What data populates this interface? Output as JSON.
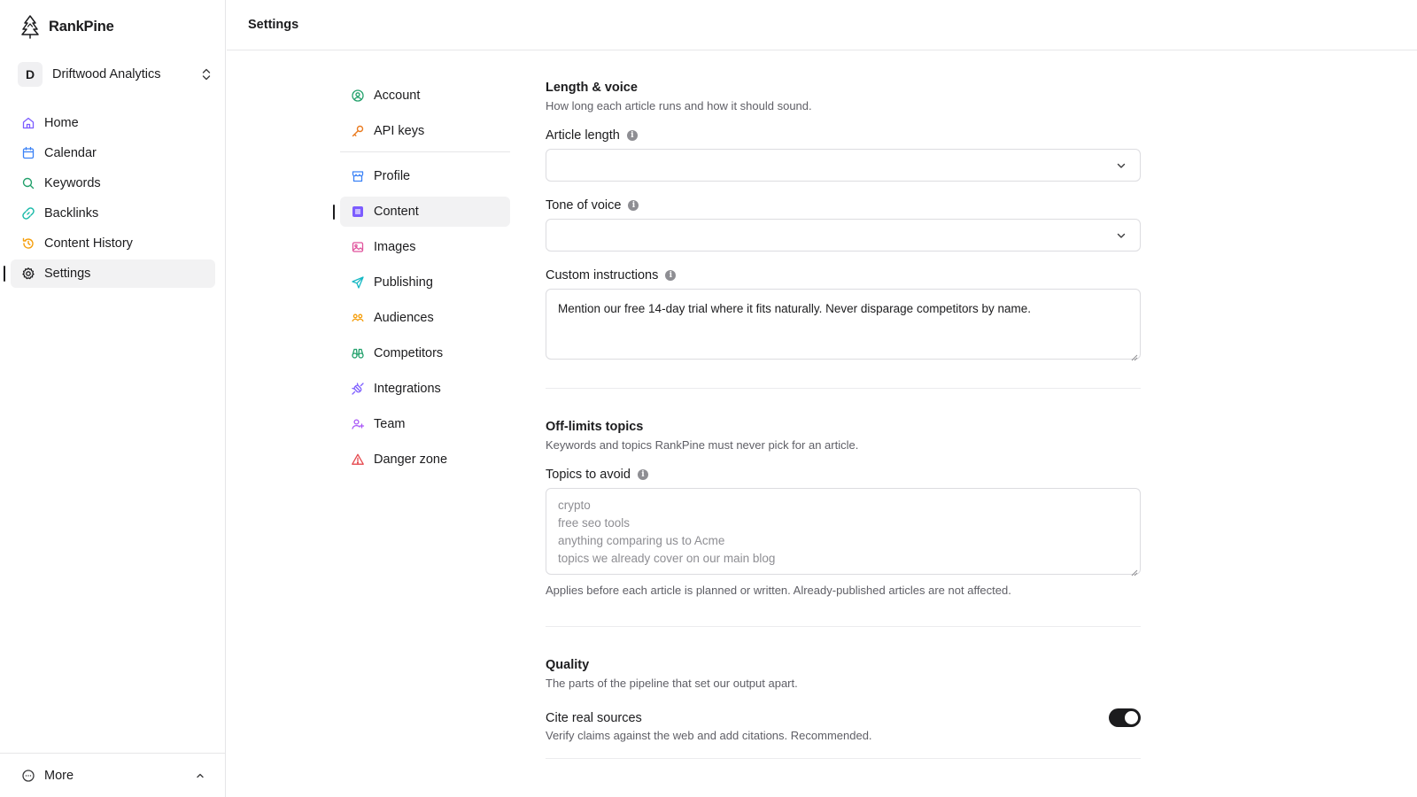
{
  "app": {
    "name": "RankPine"
  },
  "workspace": {
    "initial": "D",
    "name": "Driftwood Analytics"
  },
  "sidebar": {
    "items": [
      {
        "label": "Home",
        "icon": "home-icon"
      },
      {
        "label": "Calendar",
        "icon": "calendar-icon"
      },
      {
        "label": "Keywords",
        "icon": "search-icon"
      },
      {
        "label": "Backlinks",
        "icon": "link-icon"
      },
      {
        "label": "Content History",
        "icon": "history-icon"
      },
      {
        "label": "Settings",
        "icon": "gear-icon",
        "active": true
      }
    ],
    "more_label": "More"
  },
  "header": {
    "title": "Settings"
  },
  "settings_nav": {
    "items": [
      {
        "label": "Account",
        "icon": "user-circle-icon"
      },
      {
        "label": "API keys",
        "icon": "key-icon"
      },
      {
        "label": "Profile",
        "icon": "storefront-icon"
      },
      {
        "label": "Content",
        "icon": "content-square-icon",
        "active": true
      },
      {
        "label": "Images",
        "icon": "image-icon"
      },
      {
        "label": "Publishing",
        "icon": "send-icon"
      },
      {
        "label": "Audiences",
        "icon": "users-icon"
      },
      {
        "label": "Competitors",
        "icon": "binoculars-icon"
      },
      {
        "label": "Integrations",
        "icon": "plug-icon"
      },
      {
        "label": "Team",
        "icon": "user-plus-icon"
      },
      {
        "label": "Danger zone",
        "icon": "warning-icon"
      }
    ]
  },
  "content": {
    "length_voice": {
      "title": "Length & voice",
      "description": "How long each article runs and how it should sound.",
      "article_length_label": "Article length",
      "article_length_value": "",
      "tone_label": "Tone of voice",
      "tone_value": "",
      "custom_label": "Custom instructions",
      "custom_value": "Mention our free 14-day trial where it fits naturally. Never disparage competitors by name."
    },
    "off_limits": {
      "title": "Off-limits topics",
      "description": "Keywords and topics RankPine must never pick for an article.",
      "topics_label": "Topics to avoid",
      "topics_placeholder": [
        "crypto",
        "free seo tools",
        "anything comparing us to Acme",
        "topics we already cover on our main blog"
      ],
      "hint": "Applies before each article is planned or written. Already-published articles are not affected."
    },
    "quality": {
      "title": "Quality",
      "description": "The parts of the pipeline that set our output apart.",
      "cite_label": "Cite real sources",
      "cite_description": "Verify claims against the web and add citations. Recommended.",
      "cite_enabled": true
    }
  },
  "colors": {
    "accent_purple": "#7c5cff",
    "text_primary": "#1c1c1e",
    "text_secondary": "#5f5f66",
    "border": "#e6e6e8"
  }
}
